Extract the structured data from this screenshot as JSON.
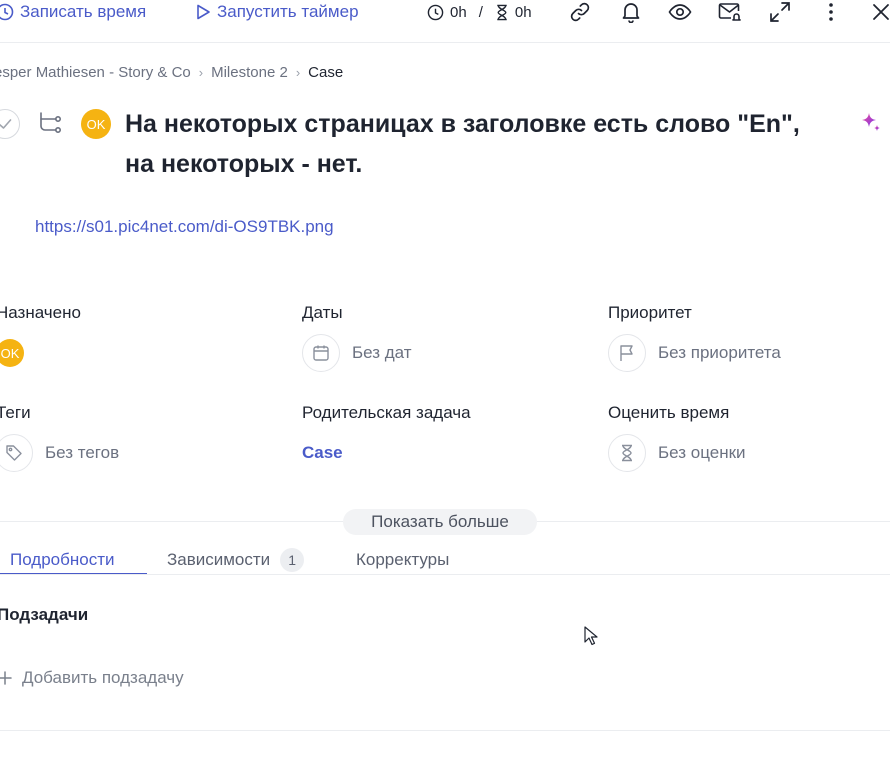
{
  "toolbar": {
    "log_time_label": "Записать время",
    "start_timer_label": "Запустить таймер",
    "tracked_time": "0h",
    "separator": "/",
    "estimate_time": "0h"
  },
  "breadcrumb": {
    "items": [
      "esper Mathiesen - Story & Co",
      "Milestone 2"
    ],
    "current": "Case"
  },
  "task": {
    "assignee_initials": "OK",
    "title": "На некоторых страницах в заголовке есть слово \"En\", на некоторых - нет.",
    "description_link": "https://s01.pic4net.com/di-OS9TBK.png"
  },
  "fields": {
    "assigned_label": "Назначено",
    "assigned_value": "OK",
    "dates_label": "Даты",
    "dates_value": "Без дат",
    "priority_label": "Приоритет",
    "priority_value": "Без приоритета",
    "tags_label": "Теги",
    "tags_value": "Без тегов",
    "parent_label": "Родительская задача",
    "parent_value": "Case",
    "estimate_label": "Оценить время",
    "estimate_value": "Без оценки"
  },
  "show_more_label": "Показать больше",
  "tabs": [
    {
      "label": "Подробности",
      "active": true
    },
    {
      "label": "Зависимости",
      "count": "1"
    },
    {
      "label": "Корректуры"
    }
  ],
  "subtasks": {
    "title": "Подзадачи",
    "add_label": "Добавить подзадачу"
  },
  "colors": {
    "accent": "#4a5bc9",
    "avatar": "#f5b312",
    "sparkle": "#8b5cf6"
  }
}
